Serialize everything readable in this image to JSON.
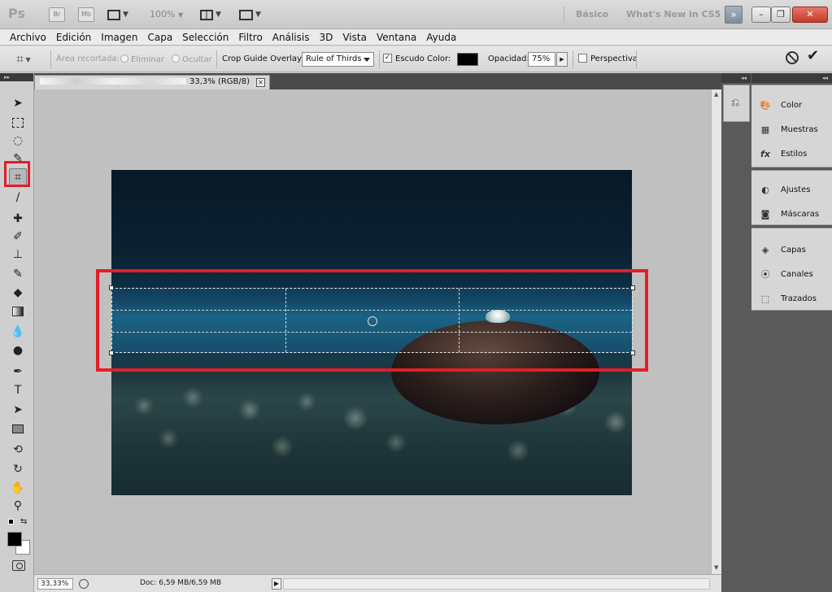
{
  "app": {
    "logo": "Ps",
    "badge_br": "Br",
    "badge_mb": "Mb",
    "zoom": "100%",
    "workspace_basic": "Básico",
    "workspace_new": "What's New in CS5",
    "more_label": "»",
    "win_minimize": "–",
    "win_restore": "❐",
    "win_close": "✕"
  },
  "menu": [
    "Archivo",
    "Edición",
    "Imagen",
    "Capa",
    "Selección",
    "Filtro",
    "Análisis",
    "3D",
    "Vista",
    "Ventana",
    "Ayuda"
  ],
  "options": {
    "cropped_area_label": "Área recortada:",
    "delete_label": "Eliminar",
    "hide_label": "Ocultar",
    "overlay_label": "Crop Guide Overlay:",
    "overlay_value": "Rule of Thirds",
    "shield_label": "Escudo",
    "shield_checked": "✓",
    "color_label": "Color:",
    "shield_color": "#000000",
    "opacity_label": "Opacidad:",
    "opacity_value": "75%",
    "perspective_label": "Perspectiva"
  },
  "document": {
    "tab_title": "33,3% (RGB/8)",
    "close": "✕",
    "zoom": "33,33%",
    "doc_size": "Doc: 6,59 MB/6,59 MB"
  },
  "panels": {
    "group1": [
      "Color",
      "Muestras",
      "Estilos"
    ],
    "group2": [
      "Ajustes",
      "Máscaras"
    ],
    "group3": [
      "Capas",
      "Canales",
      "Trazados"
    ]
  },
  "colors": {
    "highlight": "#e31e25",
    "foreground": "#000000",
    "background": "#ffffff"
  }
}
